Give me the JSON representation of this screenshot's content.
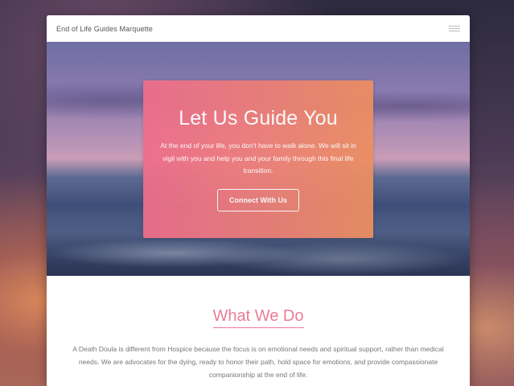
{
  "navbar": {
    "brand": "End of Life Guides Marquette",
    "menu_icon": "hamburger-menu-icon"
  },
  "hero": {
    "title": "Let Us Guide You",
    "text": "At the end of your life, you don't have to walk alone. We will sit in vigil with you and help you and your family through this final life transition.",
    "button_label": "Connect With Us"
  },
  "what_we_do": {
    "title": "What We Do",
    "text": "A Death Doula is different from Hospice because the focus is on emotional needs and spiritual support, rather than medical needs. We are advocates for the dying, ready to honor their path, hold space for emotions, and provide compassionate companionship at the end of life."
  },
  "colors": {
    "accent_pink": "#ea7c9a",
    "gradient_start": "#ee6e8c",
    "gradient_end": "#ec8f60"
  }
}
